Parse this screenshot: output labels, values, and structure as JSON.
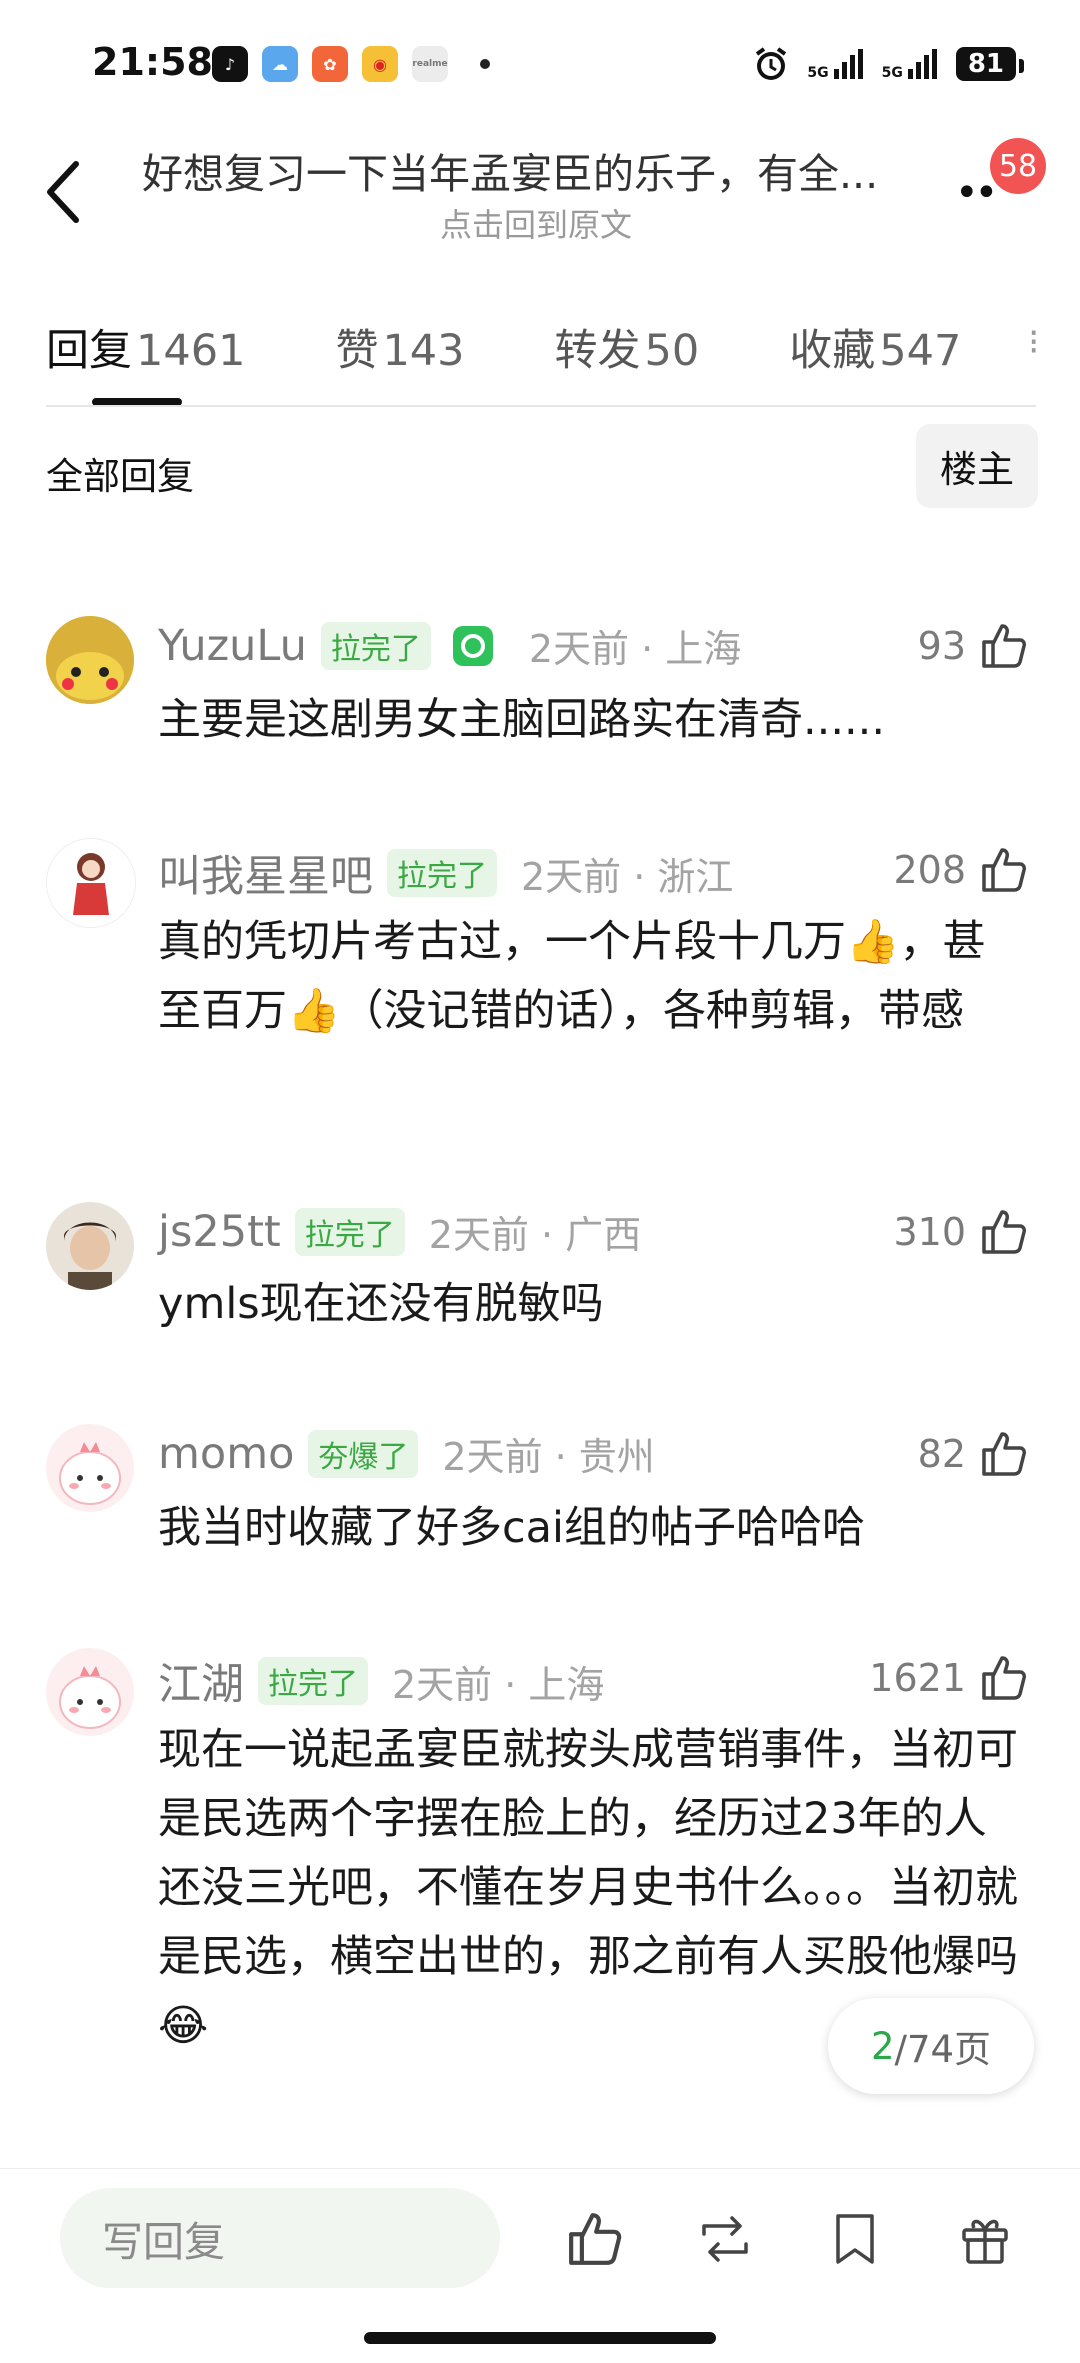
{
  "status_bar": {
    "time": "21:58",
    "battery": "81",
    "signal_1": "5G",
    "signal_2": "5G",
    "apps": [
      {
        "icon": "tiktok-icon",
        "color": "#111111"
      },
      {
        "icon": "weather-icon",
        "color": "#5aa7ee"
      },
      {
        "icon": "app-store-icon",
        "color": "#f2663a"
      },
      {
        "icon": "weibo-icon",
        "color": "#f5c036"
      },
      {
        "icon": "realme-icon",
        "color": "#e8e8e8"
      }
    ]
  },
  "header": {
    "title": "好想复习一下当年孟宴臣的乐子，有全...",
    "subtitle": "点击回到原文",
    "badge": "58"
  },
  "tabs": [
    {
      "label": "回复",
      "count": "1461"
    },
    {
      "label": "赞",
      "count": "143"
    },
    {
      "label": "转发",
      "count": "50"
    },
    {
      "label": "收藏",
      "count": "547"
    }
  ],
  "filter": {
    "all": "全部回复",
    "op": "楼主"
  },
  "comments": [
    {
      "user": "YuzuLu",
      "tag": "拉完了",
      "time": "2天前 · 上海",
      "likes": "93",
      "text": "主要是这剧男女主脑回路实在清奇......",
      "avatar_color": "#e8c23a",
      "has_extra_badge": true
    },
    {
      "user": "叫我星星吧",
      "tag": "拉完了",
      "time": "2天前 · 浙江",
      "likes": "208",
      "text": "真的凭切片考古过，一个片段十几万👍，甚至百万👍（没记错的话），各种剪辑，带感",
      "avatar_color": "#d83a3a"
    },
    {
      "user": "js25tt",
      "tag": "拉完了",
      "time": "2天前 · 广西",
      "likes": "310",
      "text": "ymls现在还没有脱敏吗",
      "avatar_color": "#c9a78a"
    },
    {
      "user": "momo",
      "tag": "夯爆了",
      "time": "2天前 · 贵州",
      "likes": "82",
      "text": "我当时收藏了好多cai组的帖子哈哈哈",
      "avatar_color": "#f4c6c9"
    },
    {
      "user": "江湖",
      "tag": "拉完了",
      "time": "2天前 · 上海",
      "likes": "1621",
      "text": "现在一说起孟宴臣就按头成营销事件，当初可是民选两个字摆在脸上的，经历过23年的人还没三光吧，不懂在岁月史书什么。。。当初就是民选，横空出世的，那之前有人买股他爆吗😂",
      "avatar_color": "#f4c6c9"
    }
  ],
  "page_indicator": {
    "current": "2",
    "total": "/74页"
  },
  "bottom": {
    "reply_placeholder": "写回复"
  },
  "colors": {
    "accent_green": "#3aa843",
    "badge_red": "#f25454"
  }
}
